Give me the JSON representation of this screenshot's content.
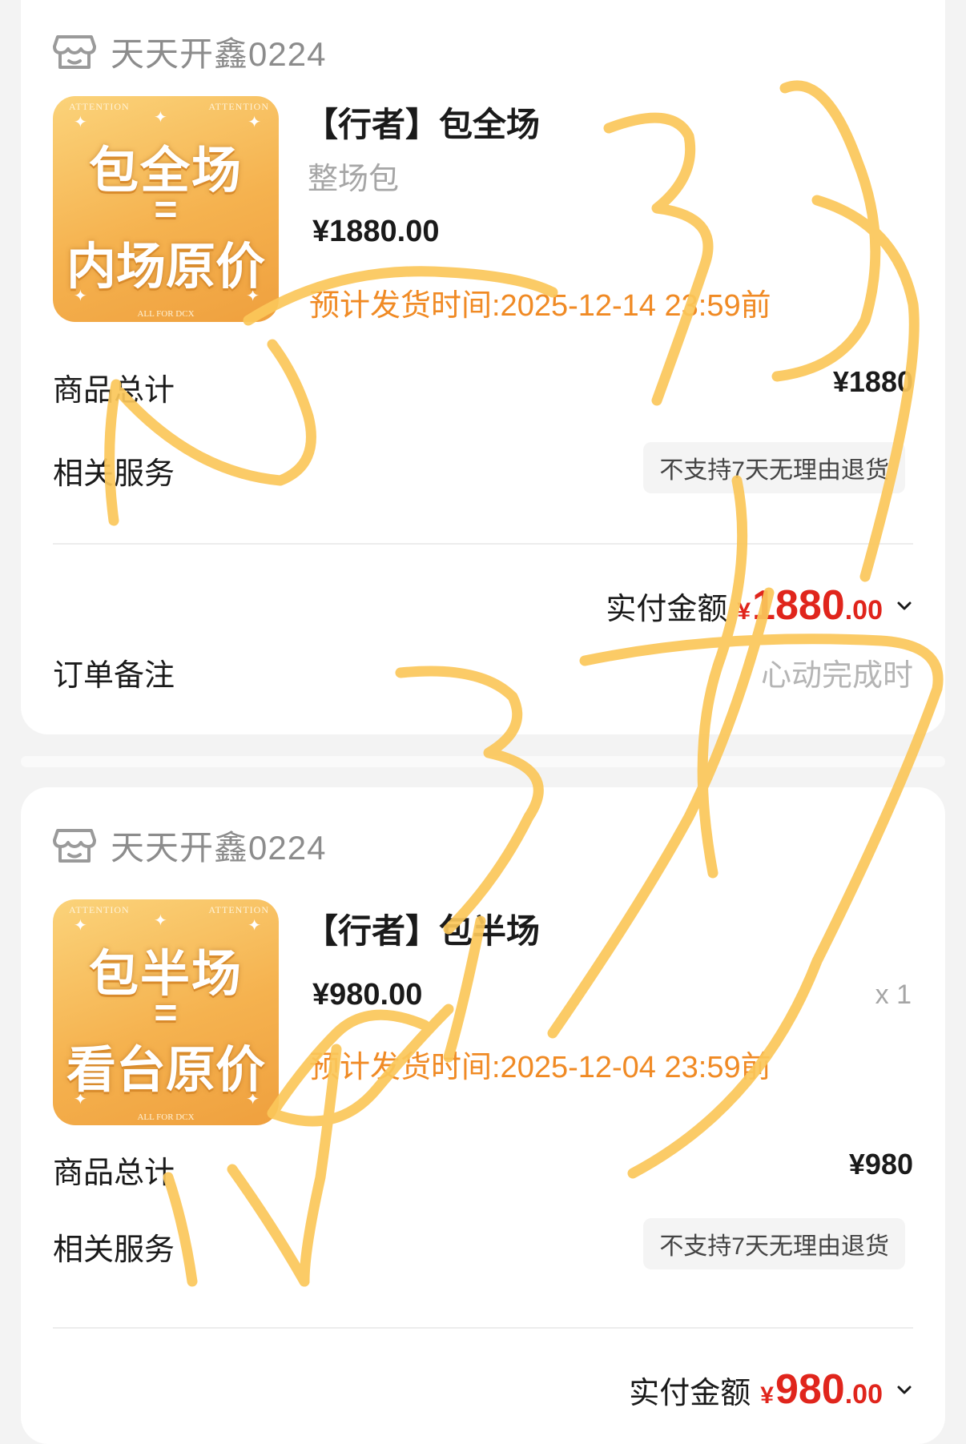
{
  "orders": [
    {
      "shop_name": "天天开鑫0224",
      "thumb": {
        "line1": "包全场",
        "line2": "=",
        "line3": "内场原价",
        "corner_left": "ATTENTION",
        "corner_right": "ATTENTION",
        "footer": "ALL FOR DCX"
      },
      "title": "【行者】包全场",
      "subtitle": "整场包",
      "price": "¥1880.00",
      "ship_time": "预计发货时间:2025-12-14 23:59前",
      "subtotal_label": "商品总计",
      "subtotal_value": "¥1880",
      "service_label": "相关服务",
      "service_tag": "不支持7天无理由退货",
      "paid_label": "实付金额",
      "paid_yen": "¥",
      "paid_int": "1880",
      "paid_dec": ".00",
      "note_label": "订单备注",
      "note_value": "心动完成时"
    },
    {
      "shop_name": "天天开鑫0224",
      "thumb": {
        "line1": "包半场",
        "line2": "=",
        "line3": "看台原价",
        "corner_left": "ATTENTION",
        "corner_right": "ATTENTION",
        "footer": "ALL FOR DCX"
      },
      "title": "【行者】包半场",
      "price": "¥980.00",
      "quantity": "x 1",
      "ship_time": "预计发货时间:2025-12-04 23:59前",
      "subtotal_label": "商品总计",
      "subtotal_value": "¥980",
      "service_label": "相关服务",
      "service_tag": "不支持7天无理由退货",
      "paid_label": "实付金额",
      "paid_yen": "¥",
      "paid_int": "980",
      "paid_dec": ".00"
    }
  ],
  "colors": {
    "accent_orange": "#f08a24",
    "price_red": "#e0251c",
    "scribble": "#fbc75a"
  },
  "icons": [
    "shop-icon",
    "chevron-down-icon"
  ]
}
